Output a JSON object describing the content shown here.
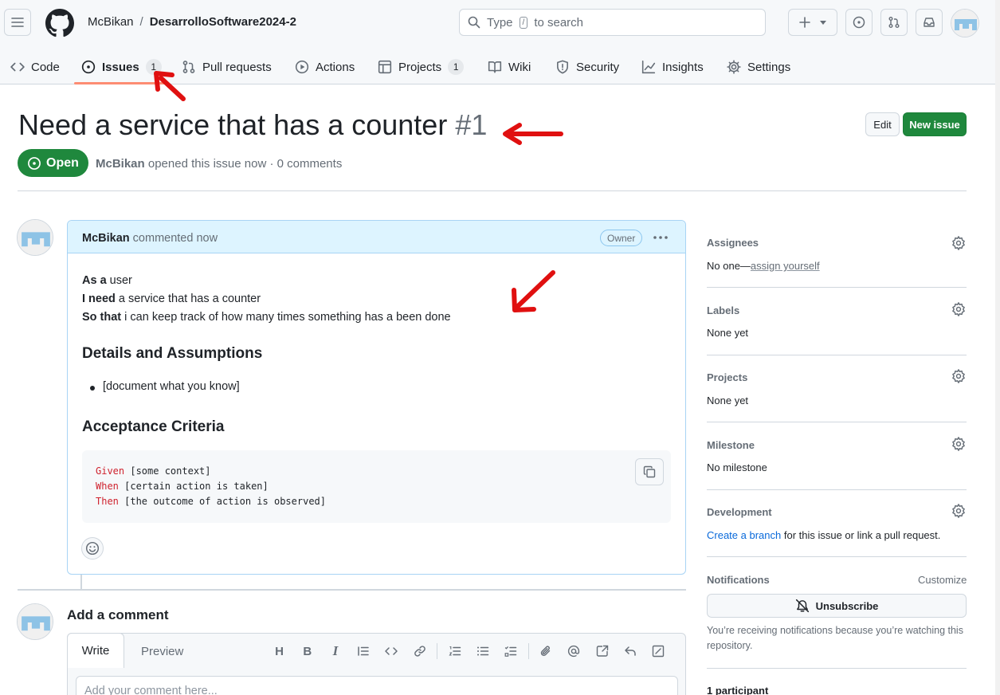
{
  "header": {
    "owner": "McBikan",
    "separator": "/",
    "repo": "DesarrolloSoftware2024-2",
    "search_prefix": "Type",
    "search_key": "/",
    "search_suffix": "to search"
  },
  "tabs": [
    {
      "label": "Code",
      "icon": "code-icon"
    },
    {
      "label": "Issues",
      "icon": "issue-opened-icon",
      "count": "1",
      "active": true
    },
    {
      "label": "Pull requests",
      "icon": "git-pull-request-icon"
    },
    {
      "label": "Actions",
      "icon": "play-icon"
    },
    {
      "label": "Projects",
      "icon": "table-icon",
      "count": "1"
    },
    {
      "label": "Wiki",
      "icon": "book-icon"
    },
    {
      "label": "Security",
      "icon": "shield-icon"
    },
    {
      "label": "Insights",
      "icon": "graph-icon"
    },
    {
      "label": "Settings",
      "icon": "gear-icon"
    }
  ],
  "issue": {
    "title": "Need a service that has a counter",
    "number": "#1",
    "edit_label": "Edit",
    "new_issue_label": "New issue",
    "state": "Open",
    "author": "McBikan",
    "meta_rest": "opened this issue now · 0 comments"
  },
  "comment": {
    "author": "McBikan",
    "action": "commented now",
    "badge": "Owner",
    "lines": [
      {
        "bold": "As a",
        "rest": " user"
      },
      {
        "bold": "I need",
        "rest": " a service that has a counter"
      },
      {
        "bold": "So that",
        "rest": " i can keep track of how many times something has a been done"
      }
    ],
    "heading1": "Details and Assumptions",
    "bullet": "[document what you know]",
    "heading2": "Acceptance Criteria",
    "code": [
      {
        "kw": "Given",
        "rest": " [some context]"
      },
      {
        "kw": "When",
        "rest": " [certain action is taken]"
      },
      {
        "kw": "Then",
        "rest": " [the outcome of action is observed]"
      }
    ]
  },
  "add_comment": {
    "title": "Add a comment",
    "write_tab": "Write",
    "preview_tab": "Preview",
    "placeholder": "Add your comment here..."
  },
  "sidebar": {
    "assignees": {
      "title": "Assignees",
      "value_prefix": "No one—",
      "value_link": "assign yourself"
    },
    "labels": {
      "title": "Labels",
      "value": "None yet"
    },
    "projects": {
      "title": "Projects",
      "value": "None yet"
    },
    "milestone": {
      "title": "Milestone",
      "value": "No milestone"
    },
    "development": {
      "title": "Development",
      "link": "Create a branch",
      "rest": " for this issue or link a pull request."
    },
    "notifications": {
      "title": "Notifications",
      "customize": "Customize",
      "button": "Unsubscribe",
      "note": "You’re receiving notifications because you’re watching this repository."
    },
    "participants": {
      "title": "1 participant"
    }
  },
  "colors": {
    "accent_green": "#1f883d",
    "link_blue": "#0969da",
    "tab_underline": "#fd8c73",
    "annotation_red": "#e01010"
  }
}
